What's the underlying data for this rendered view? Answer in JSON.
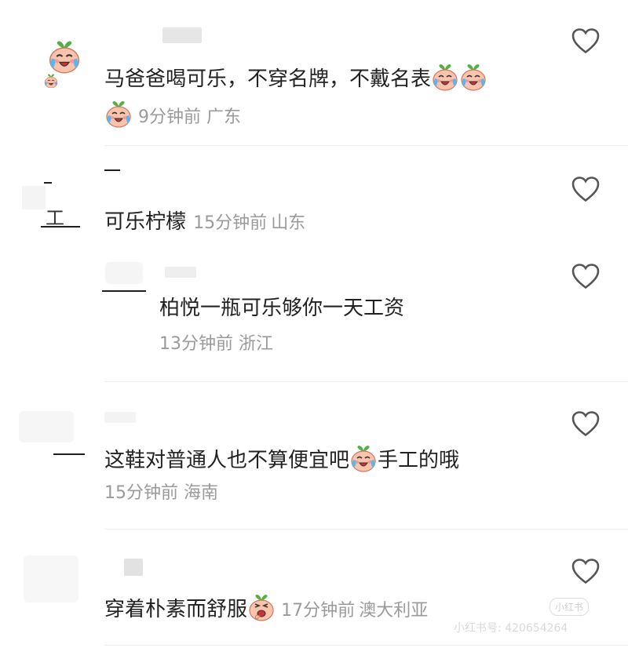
{
  "comments": [
    {
      "text": "马爸爸喝可乐，不穿名牌，不戴名表",
      "time": "9分钟前",
      "location": "广东",
      "emojis": [
        "crying-peach-emoji",
        "crying-peach-emoji",
        "crying-peach-emoji"
      ]
    },
    {
      "text": "可乐柠檬",
      "time": "15分钟前",
      "location": "山东",
      "emojis": []
    },
    {
      "text": "柏悦一瓶可乐够你一天工资",
      "time": "13分钟前",
      "location": "浙江",
      "emojis": []
    },
    {
      "text_before": "这鞋对普通人也不算便宜吧",
      "text_after": "手工的哦",
      "time": "15分钟前",
      "location": "海南",
      "emojis": [
        "crying-peach-emoji"
      ]
    },
    {
      "text": "穿着朴素而舒服",
      "time": "17分钟前",
      "location": "澳大利亚",
      "emojis": [
        "laughing-peach-emoji"
      ]
    }
  ],
  "avatar_partial_text": "工",
  "watermark": {
    "logo": "小红书",
    "id_text": "小红书号: 420654264"
  },
  "colors": {
    "text": "#222222",
    "meta": "#9a9a9a",
    "heart": "#555555",
    "divider": "#eeeeee"
  }
}
